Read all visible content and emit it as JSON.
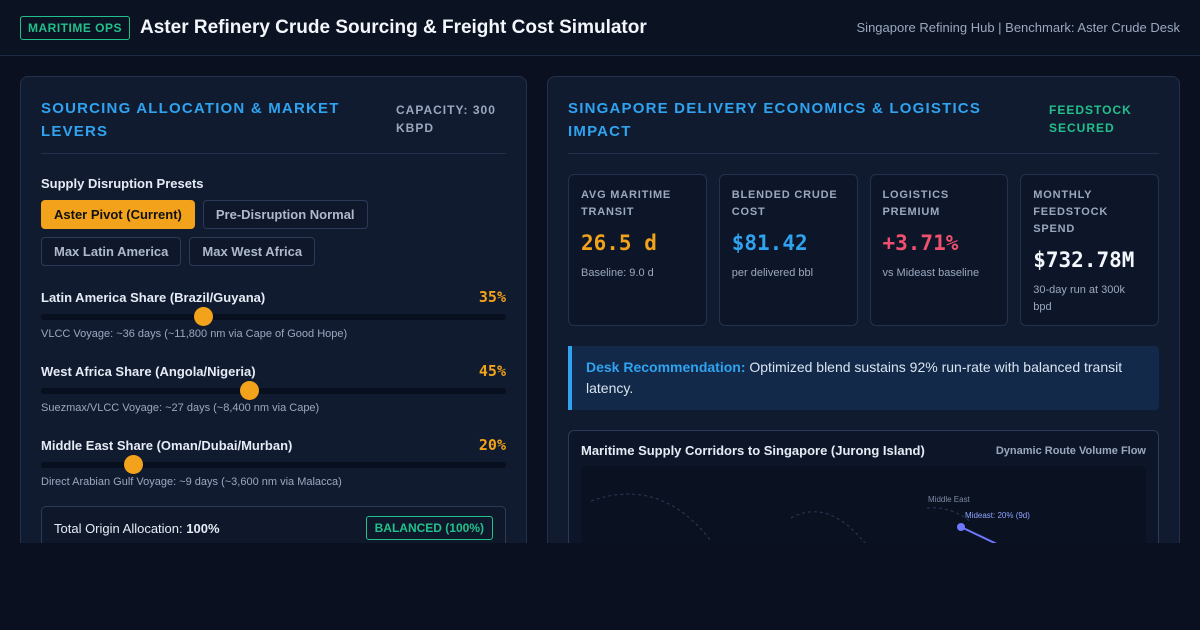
{
  "header": {
    "badge": "MARITIME OPS",
    "title": "Aster Refinery Crude Sourcing & Freight Cost Simulator",
    "context": "Singapore Refining Hub | Benchmark: Aster Crude Desk"
  },
  "left": {
    "title": "SOURCING ALLOCATION & MARKET LEVERS",
    "capacity": "CAPACITY: 300 KBPD",
    "presets_label": "Supply Disruption Presets",
    "presets": [
      "Aster Pivot (Current)",
      "Pre-Disruption Normal",
      "Max Latin America",
      "Max West Africa"
    ],
    "active_preset": "Aster Pivot (Current)",
    "sliders": [
      {
        "label": "Latin America Share (Brazil/Guyana)",
        "value": "35%",
        "level": 0.35,
        "note": "VLCC Voyage: ~36 days (~11,800 nm via Cape of Good Hope)"
      },
      {
        "label": "West Africa Share (Angola/Nigeria)",
        "value": "45%",
        "level": 0.45,
        "note": "Suezmax/VLCC Voyage: ~27 days (~8,400 nm via Cape)"
      },
      {
        "label": "Middle East Share (Oman/Dubai/Murban)",
        "value": "20%",
        "level": 0.2,
        "note": "Direct Arabian Gulf Voyage: ~9 days (~3,600 nm via Malacca)"
      }
    ],
    "total_label": "Total Origin Allocation:",
    "total_value": "100%",
    "total_badge": "BALANCED (100%)"
  },
  "right": {
    "title": "SINGAPORE DELIVERY ECONOMICS & LOGISTICS IMPACT",
    "status": "FEEDSTOCK SECURED",
    "kpis": [
      {
        "label": "AVG MARITIME TRANSIT",
        "value": "26.5 d",
        "note": "Baseline: 9.0 d",
        "color": "#f2a21b"
      },
      {
        "label": "BLENDED CRUDE COST",
        "value": "$81.42",
        "note": "per delivered bbl",
        "color": "#2fa3f0"
      },
      {
        "label": "LOGISTICS PREMIUM",
        "value": "+3.71%",
        "note": "vs Mideast baseline",
        "color": "#f0506e"
      },
      {
        "label": "MONTHLY FEEDSTOCK SPEND",
        "value": "$732.78M",
        "note": "30-day run at 300k bpd",
        "color": "#f3f6fb"
      }
    ],
    "reco_label": "Desk Recommendation:",
    "reco_text": "Optimized blend sustains 92% run-rate with balanced transit latency.",
    "map": {
      "title": "Maritime Supply Corridors to Singapore (Jurong Island)",
      "subtitle": "Dynamic Route Volume Flow",
      "region_label": "Middle East",
      "route_label": "Mideast: 20% (9d)"
    }
  }
}
